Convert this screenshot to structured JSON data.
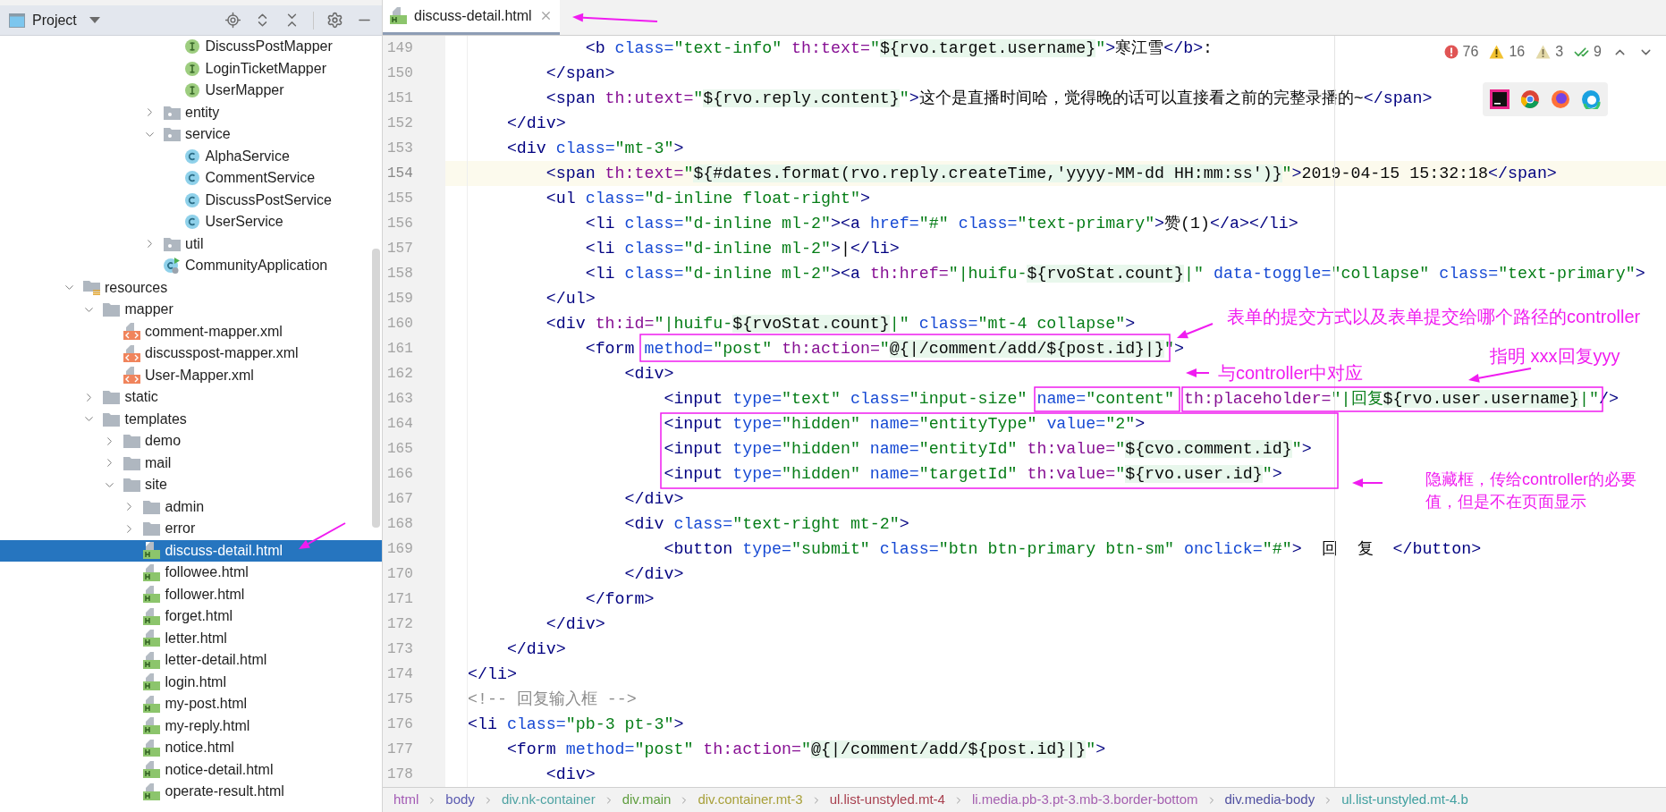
{
  "sidebar": {
    "title": "Project",
    "tree": [
      {
        "children": [
          {
            "children": [
              {
                "children": [
                  {
                    "children": [
                      {
                        "children": [
                          {
                            "label": "DiscussPostMapper",
                            "kind": "interface",
                            "selected": false
                          },
                          {
                            "label": "LoginTicketMapper",
                            "kind": "interface",
                            "selected": false
                          },
                          {
                            "label": "UserMapper",
                            "kind": "interface",
                            "selected": false
                          }
                        ]
                      },
                      {
                        "label": "entity",
                        "kind": "package",
                        "expanded": false,
                        "selected": false
                      },
                      {
                        "label": "service",
                        "kind": "package",
                        "expanded": true,
                        "selected": false,
                        "children": [
                          {
                            "label": "AlphaService",
                            "kind": "class",
                            "selected": false
                          },
                          {
                            "label": "CommentService",
                            "kind": "class",
                            "selected": false
                          },
                          {
                            "label": "DiscussPostService",
                            "kind": "class",
                            "selected": false
                          },
                          {
                            "label": "UserService",
                            "kind": "class",
                            "selected": false
                          }
                        ]
                      },
                      {
                        "label": "util",
                        "kind": "package",
                        "expanded": false,
                        "selected": false
                      },
                      {
                        "label": "CommunityApplication",
                        "kind": "main-class",
                        "selected": false
                      }
                    ]
                  }
                ]
              }
            ]
          }
        ]
      },
      {
        "label": "resources",
        "kind": "resources-folder",
        "expanded": true,
        "selected": false,
        "children": [
          {
            "label": "mapper",
            "kind": "folder",
            "expanded": true,
            "selected": false,
            "children": [
              {
                "label": "comment-mapper.xml",
                "kind": "xml",
                "selected": false
              },
              {
                "label": "discusspost-mapper.xml",
                "kind": "xml",
                "selected": false
              },
              {
                "label": "User-Mapper.xml",
                "kind": "xml",
                "selected": false
              }
            ]
          },
          {
            "label": "static",
            "kind": "folder",
            "expanded": false,
            "selected": false
          },
          {
            "label": "templates",
            "kind": "folder",
            "expanded": true,
            "selected": false,
            "children": [
              {
                "label": "demo",
                "kind": "folder",
                "expanded": false,
                "selected": false
              },
              {
                "label": "mail",
                "kind": "folder",
                "expanded": false,
                "selected": false
              },
              {
                "label": "site",
                "kind": "folder",
                "expanded": true,
                "selected": false,
                "children": [
                  {
                    "label": "admin",
                    "kind": "folder",
                    "expanded": false,
                    "selected": false
                  },
                  {
                    "label": "error",
                    "kind": "folder",
                    "expanded": false,
                    "selected": false
                  },
                  {
                    "label": "discuss-detail.html",
                    "kind": "html",
                    "selected": true
                  },
                  {
                    "label": "followee.html",
                    "kind": "html",
                    "selected": false
                  },
                  {
                    "label": "follower.html",
                    "kind": "html",
                    "selected": false
                  },
                  {
                    "label": "forget.html",
                    "kind": "html",
                    "selected": false
                  },
                  {
                    "label": "letter.html",
                    "kind": "html",
                    "selected": false
                  },
                  {
                    "label": "letter-detail.html",
                    "kind": "html",
                    "selected": false
                  },
                  {
                    "label": "login.html",
                    "kind": "html",
                    "selected": false
                  },
                  {
                    "label": "my-post.html",
                    "kind": "html",
                    "selected": false
                  },
                  {
                    "label": "my-reply.html",
                    "kind": "html",
                    "selected": false
                  },
                  {
                    "label": "notice.html",
                    "kind": "html",
                    "selected": false
                  },
                  {
                    "label": "notice-detail.html",
                    "kind": "html",
                    "selected": false
                  },
                  {
                    "label": "operate-result.html",
                    "kind": "html",
                    "selected": false
                  }
                ]
              }
            ]
          }
        ]
      }
    ]
  },
  "tabs": [
    {
      "label": "discuss-detail.html",
      "selected": true
    }
  ],
  "inspections": [
    {
      "kind": "error",
      "count": "76"
    },
    {
      "kind": "warning",
      "count": "16"
    },
    {
      "kind": "weak-warning",
      "count": "3"
    },
    {
      "kind": "typo",
      "count": "9"
    }
  ],
  "code": [
    {
      "number": "149",
      "text": "            <b class=\"text-info\" th:text=\"${rvo.target.username}\">寒江雪</b>:",
      "current": false
    },
    {
      "number": "150",
      "text": "        </span>",
      "current": false
    },
    {
      "number": "151",
      "text": "        <span th:utext=\"${rvo.reply.content}\">这个是直播时间哈，觉得晚的话可以直接看之前的完整录播的~</span>",
      "current": false
    },
    {
      "number": "152",
      "text": "    </div>",
      "current": false
    },
    {
      "number": "153",
      "text": "    <div class=\"mt-3\">",
      "current": false
    },
    {
      "number": "154",
      "text": "        <span th:text=\"${#dates.format(rvo.reply.createTime,'yyyy-MM-dd HH:mm:ss')}\">2019-04-15 15:32:18</span>",
      "current": true
    },
    {
      "number": "155",
      "text": "        <ul class=\"d-inline float-right\">",
      "current": false
    },
    {
      "number": "156",
      "text": "            <li class=\"d-inline ml-2\"><a href=\"#\" class=\"text-primary\">赞(1)</a></li>",
      "current": false
    },
    {
      "number": "157",
      "text": "            <li class=\"d-inline ml-2\">|</li>",
      "current": false
    },
    {
      "number": "158",
      "text": "            <li class=\"d-inline ml-2\"><a th:href=\"|huifu-${rvoStat.count}|\" data-toggle=\"collapse\" class=\"text-primary\">",
      "current": false
    },
    {
      "number": "159",
      "text": "        </ul>",
      "current": false
    },
    {
      "number": "160",
      "text": "        <div th:id=\"|huifu-${rvoStat.count}|\" class=\"mt-4 collapse\">",
      "current": false
    },
    {
      "number": "161",
      "text": "            <form method=\"post\" th:action=\"@{|/comment/add/${post.id}|}\">",
      "current": false
    },
    {
      "number": "162",
      "text": "                <div>",
      "current": false
    },
    {
      "number": "163",
      "text": "                    <input type=\"text\" class=\"input-size\" name=\"content\" th:placeholder=\"|回复${rvo.user.username}|\"/>",
      "current": false
    },
    {
      "number": "164",
      "text": "                    <input type=\"hidden\" name=\"entityType\" value=\"2\">",
      "current": false
    },
    {
      "number": "165",
      "text": "                    <input type=\"hidden\" name=\"entityId\" th:value=\"${cvo.comment.id}\">",
      "current": false
    },
    {
      "number": "166",
      "text": "                    <input type=\"hidden\" name=\"targetId\" th:value=\"${rvo.user.id}\">",
      "current": false
    },
    {
      "number": "167",
      "text": "                </div>",
      "current": false
    },
    {
      "number": "168",
      "text": "                <div class=\"text-right mt-2\">",
      "current": false
    },
    {
      "number": "169",
      "text": "                    <button type=\"submit\" class=\"btn btn-primary btn-sm\" onclick=\"#\">  回  复  </button>",
      "current": false
    },
    {
      "number": "170",
      "text": "                </div>",
      "current": false
    },
    {
      "number": "171",
      "text": "            </form>",
      "current": false
    },
    {
      "number": "172",
      "text": "        </div>",
      "current": false
    },
    {
      "number": "173",
      "text": "    </div>",
      "current": false
    },
    {
      "number": "174",
      "text": "</li>",
      "current": false
    },
    {
      "number": "175",
      "text": "<!-- 回复输入框 -->",
      "current": false
    },
    {
      "number": "176",
      "text": "<li class=\"pb-3 pt-3\">",
      "current": false
    },
    {
      "number": "177",
      "text": "    <form method=\"post\" th:action=\"@{|/comment/add/${post.id}|}\">",
      "current": false
    },
    {
      "number": "178",
      "text": "        <div>",
      "current": false
    }
  ],
  "breadcrumb": [
    {
      "label": "html",
      "color": "#a35bb5"
    },
    {
      "label": "body",
      "color": "#5a5ab0"
    },
    {
      "label": "div.nk-container",
      "color": "#4fa3a3"
    },
    {
      "label": "div.main",
      "color": "#5f9e3f"
    },
    {
      "label": "div.container.mt-3",
      "color": "#a8a03a"
    },
    {
      "label": "ul.list-unstyled.mt-4",
      "color": "#a8404f"
    },
    {
      "label": "li.media.pb-3.pt-3.mb-3.border-bottom",
      "color": "#a560b0"
    },
    {
      "label": "div.media-body",
      "color": "#4f4fa0"
    },
    {
      "label": "ul.list-unstyled.mt-4.b",
      "color": "#3f9f9f"
    }
  ],
  "annotations": [
    "表单的提交方式以及表单提交给哪个路径的controller",
    "与controller中对应",
    "指明 xxx回复yyy",
    "隐藏框，传给controller的必要值，但是不在页面显示"
  ]
}
